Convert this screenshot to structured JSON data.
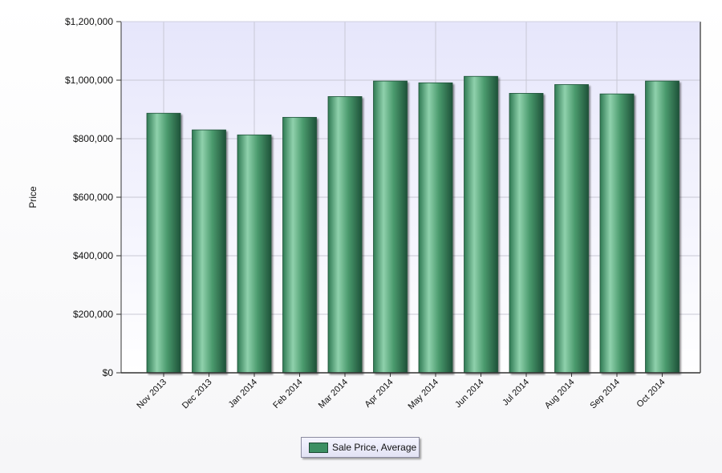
{
  "chart_data": {
    "type": "bar",
    "title": "",
    "xlabel": "",
    "ylabel": "Price",
    "categories": [
      "Nov 2013",
      "Dec 2013",
      "Jan 2014",
      "Feb 2014",
      "Mar 2014",
      "Apr 2014",
      "May 2014",
      "Jun 2014",
      "Jul 2014",
      "Aug 2014",
      "Sep 2014",
      "Oct 2014"
    ],
    "series": [
      {
        "name": "Sale Price, Average",
        "values": [
          887000,
          830000,
          813000,
          873000,
          944000,
          997000,
          991000,
          1013000,
          955000,
          985000,
          953000,
          997000
        ]
      }
    ],
    "ylim": [
      0,
      1200000
    ],
    "y_ticks": [
      0,
      200000,
      400000,
      600000,
      800000,
      1000000,
      1200000
    ],
    "y_tick_labels": [
      "$0",
      "$200,000",
      "$400,000",
      "$600,000",
      "$800,000",
      "$1,000,000",
      "$1,200,000"
    ],
    "grid": true,
    "legend_position": "bottom-center",
    "colors": {
      "bar": "#3d8f63",
      "bar_light": "#8fd1ac",
      "bar_dark": "#1e5239",
      "plot_background_top": "#e6e6fb",
      "plot_background_bottom": "#ffffff",
      "grid": "#c8c8d4"
    }
  }
}
